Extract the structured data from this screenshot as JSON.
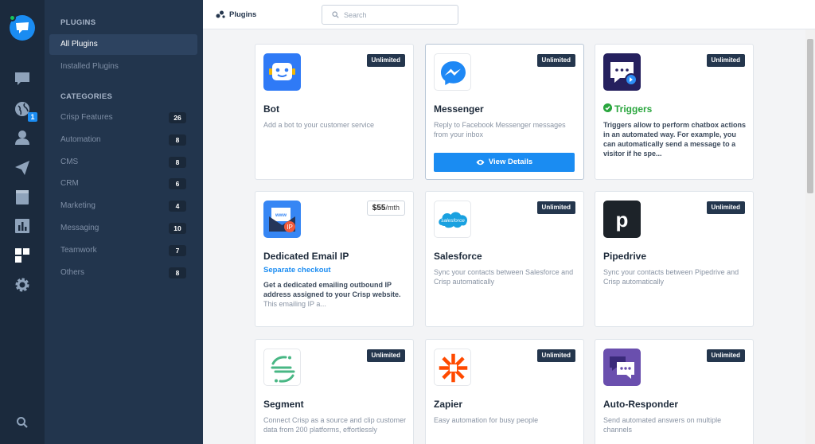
{
  "rail": {
    "notification_count": "1"
  },
  "sidebar": {
    "plugins_heading": "PLUGINS",
    "items": [
      {
        "label": "All Plugins"
      },
      {
        "label": "Installed Plugins"
      }
    ],
    "categories_heading": "CATEGORIES",
    "categories": [
      {
        "label": "Crisp Features",
        "count": "26"
      },
      {
        "label": "Automation",
        "count": "8"
      },
      {
        "label": "CMS",
        "count": "8"
      },
      {
        "label": "CRM",
        "count": "6"
      },
      {
        "label": "Marketing",
        "count": "4"
      },
      {
        "label": "Messaging",
        "count": "10"
      },
      {
        "label": "Teamwork",
        "count": "7"
      },
      {
        "label": "Others",
        "count": "8"
      }
    ]
  },
  "topbar": {
    "title": "Plugins",
    "search_placeholder": "Search"
  },
  "cards": [
    {
      "title": "Bot",
      "tag": "Unlimited",
      "desc": "Add a bot to your customer service",
      "icon": "bot-icon"
    },
    {
      "title": "Messenger",
      "tag": "Unlimited",
      "desc": "Reply to Facebook Messenger messages from your inbox",
      "button": "View Details",
      "icon": "messenger-icon"
    },
    {
      "title": "Triggers",
      "tag": "Unlimited",
      "desc": "Triggers allow to perform chatbox actions in an automated way. For example, you can automatically send a message to a visitor if he spe...",
      "icon": "triggers-icon"
    },
    {
      "title": "Dedicated Email IP",
      "price": "$55",
      "price_unit": "/mth",
      "sub": "Separate checkout",
      "desc_bold": "Get a dedicated emailing outbound IP address assigned to your Crisp website.",
      "desc_muted": "This emailing IP a...",
      "icon": "email-ip-icon"
    },
    {
      "title": "Salesforce",
      "tag": "Unlimited",
      "desc": "Sync your contacts between Salesforce and Crisp automatically",
      "icon": "salesforce-icon",
      "logo_text": "salesforce"
    },
    {
      "title": "Pipedrive",
      "tag": "Unlimited",
      "desc": "Sync your contacts between Pipedrive and Crisp automatically",
      "icon": "pipedrive-icon",
      "logo_text": "p"
    },
    {
      "title": "Segment",
      "tag": "Unlimited",
      "desc": "Connect Crisp as a source and clip customer data from 200 platforms, effortlessly",
      "icon": "segment-icon"
    },
    {
      "title": "Zapier",
      "tag": "Unlimited",
      "desc": "Easy automation for busy people",
      "icon": "zapier-icon"
    },
    {
      "title": "Auto-Responder",
      "tag": "Unlimited",
      "desc": "Send automated answers on multiple channels",
      "icon": "auto-responder-icon"
    }
  ],
  "colors": {
    "accent": "#1a8cf2",
    "sidebar_bg": "#22354d",
    "rail_bg": "#1b2a3d",
    "tag_bg": "#24364d",
    "success": "#2aa63e"
  }
}
